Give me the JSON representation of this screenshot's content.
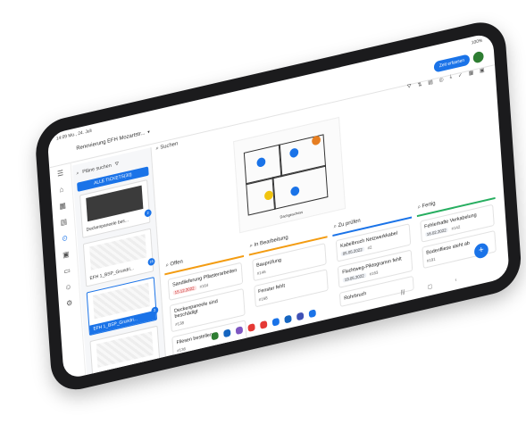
{
  "status": {
    "time": "14:09",
    "date": "Mo., 24. Juli",
    "system": "100%"
  },
  "header": {
    "project": "Renovierung EFH Mozartstr...",
    "primary_action": "Zeit erfassen"
  },
  "plans": {
    "search_placeholder": "Pläne suchen",
    "all_tickets": "ALLE TICKETS(30)",
    "items": [
      {
        "label": "Deckenpaneele bes...",
        "badge": "2"
      },
      {
        "label": "EFH 1_BSP_Grundri...",
        "badge": "16"
      },
      {
        "label": "EFH 1_BSP_Grundri...",
        "badge": "2"
      },
      {
        "label": "EFH 1_BSP_Grundri...",
        "badge": ""
      }
    ]
  },
  "main": {
    "search_label": "Suchen",
    "drawing_caption": "Dachgeschoss"
  },
  "columns": [
    {
      "title": "Offen",
      "color": "#f39c12",
      "cards": [
        {
          "title": "Sandlieferung Pflasterarbeiten",
          "date": "15.12.2022",
          "id": "#164"
        },
        {
          "title": "Deckenpaneele sind beschädigt",
          "date": "",
          "id": "#138"
        },
        {
          "title": "Fliesen bestellen",
          "date": "",
          "id": "#136"
        }
      ]
    },
    {
      "title": "In Bearbeitung",
      "color": "#f39c12",
      "cards": [
        {
          "title": "Bauprüfung",
          "date": "",
          "id": "#146"
        },
        {
          "title": "Fenster fehlt",
          "date": "",
          "id": "#168"
        }
      ]
    },
    {
      "title": "Zu prüfen",
      "color": "#1a73e8",
      "cards": [
        {
          "title": "Kabelbruch Netzwerkkabel",
          "date": "05.05.2022",
          "id": "#2"
        },
        {
          "title": "Fluchtweg-Piktogramm fehlt",
          "date": "19.05.2022",
          "id": "#163"
        },
        {
          "title": "Rohrbruch",
          "date": "",
          "id": ""
        }
      ]
    },
    {
      "title": "Fertig",
      "color": "#27ae60",
      "cards": [
        {
          "title": "Fehlerhafte Verkabelung",
          "date": "16.02.2022",
          "id": "#142"
        },
        {
          "title": "Bodenfliese steht ab",
          "date": "",
          "id": "#191"
        }
      ]
    }
  ]
}
